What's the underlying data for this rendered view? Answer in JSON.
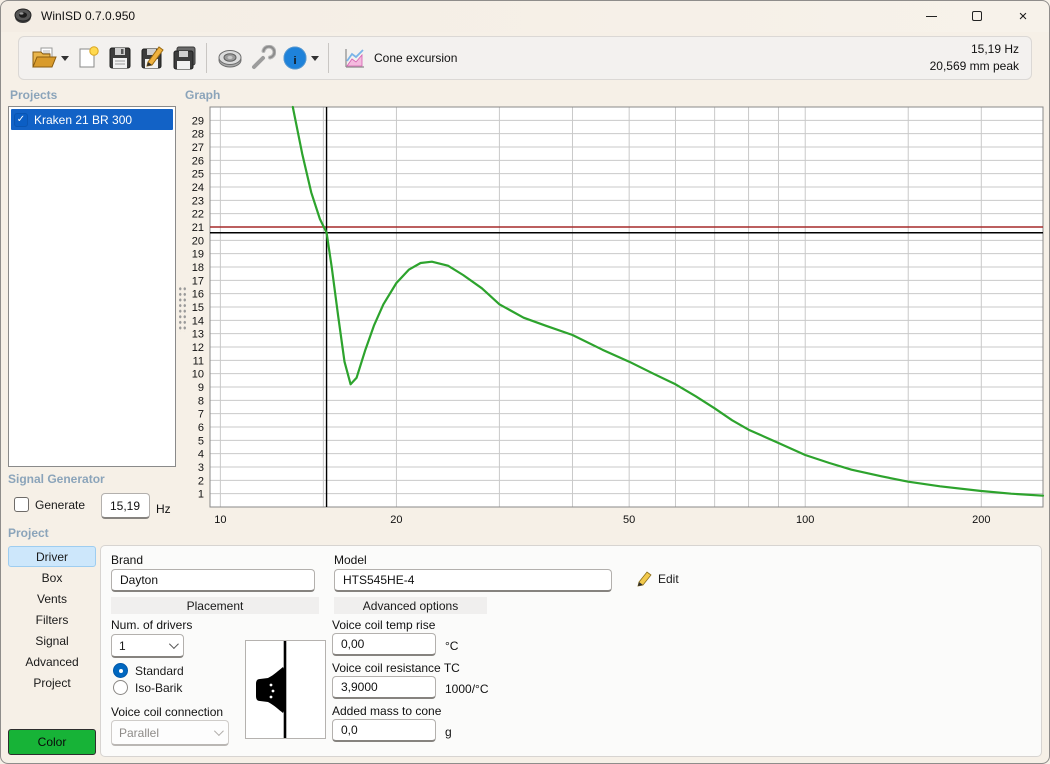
{
  "window": {
    "title": "WinISD 0.7.0.950",
    "controls": {
      "minimize": "minimize",
      "maximize": "maximize",
      "close": "×"
    }
  },
  "toolbar": {
    "buttons": [
      "open-project",
      "new-project",
      "save",
      "save-as",
      "save-all",
      "driver-database",
      "options",
      "info"
    ],
    "view_label": "Cone excursion",
    "readout_line1": "15,19 Hz",
    "readout_line2": "20,569 mm peak"
  },
  "projects": {
    "header": "Projects",
    "items": [
      {
        "label": "Kraken 21 BR 300",
        "checked": true,
        "selected": true
      }
    ]
  },
  "graph": {
    "header": "Graph"
  },
  "chart_data": {
    "type": "line",
    "title": "Cone excursion",
    "xlabel": "",
    "ylabel": "",
    "x_scale": "log",
    "xlim": [
      9.6,
      255
    ],
    "ylim": [
      0,
      30
    ],
    "grid": true,
    "x_tick_labels": [
      10,
      20,
      50,
      100,
      200
    ],
    "x_gridlines": [
      10,
      15,
      20,
      30,
      40,
      50,
      60,
      70,
      80,
      90,
      100,
      150,
      200
    ],
    "y_ticks": [
      1,
      2,
      3,
      4,
      5,
      6,
      7,
      8,
      9,
      10,
      11,
      12,
      13,
      14,
      15,
      16,
      17,
      18,
      19,
      20,
      21,
      22,
      23,
      24,
      25,
      26,
      27,
      28,
      29
    ],
    "reference_lines": [
      {
        "label": "limit-line",
        "orientation": "horizontal",
        "value": 21,
        "color": "#a52a2a"
      },
      {
        "label": "cursor-excursion",
        "orientation": "horizontal",
        "value": 20.569,
        "color": "#000000"
      },
      {
        "label": "cursor-frequency",
        "orientation": "vertical",
        "value": 15.19,
        "color": "#000000"
      }
    ],
    "series": [
      {
        "name": "Kraken 21 BR 300",
        "color": "#2da32d",
        "points": [
          [
            13.3,
            30
          ],
          [
            13.8,
            26.5
          ],
          [
            14.3,
            23.6
          ],
          [
            14.8,
            21.6
          ],
          [
            15.19,
            20.57
          ],
          [
            15.5,
            18.0
          ],
          [
            15.9,
            14.3
          ],
          [
            16.3,
            10.9
          ],
          [
            16.7,
            9.2
          ],
          [
            17.1,
            9.7
          ],
          [
            17.7,
            11.8
          ],
          [
            18.3,
            13.6
          ],
          [
            19,
            15.2
          ],
          [
            20,
            16.8
          ],
          [
            21,
            17.8
          ],
          [
            22,
            18.3
          ],
          [
            23,
            18.4
          ],
          [
            24.5,
            18.1
          ],
          [
            26,
            17.4
          ],
          [
            28,
            16.4
          ],
          [
            30,
            15.2
          ],
          [
            33,
            14.2
          ],
          [
            36,
            13.6
          ],
          [
            40,
            12.9
          ],
          [
            45,
            11.8
          ],
          [
            50,
            10.9
          ],
          [
            55,
            10.0
          ],
          [
            60,
            9.2
          ],
          [
            65,
            8.3
          ],
          [
            70,
            7.4
          ],
          [
            75,
            6.5
          ],
          [
            80,
            5.8
          ],
          [
            90,
            4.8
          ],
          [
            100,
            3.9
          ],
          [
            110,
            3.3
          ],
          [
            120,
            2.8
          ],
          [
            135,
            2.3
          ],
          [
            150,
            1.9
          ],
          [
            170,
            1.55
          ],
          [
            200,
            1.2
          ],
          [
            225,
            1.0
          ],
          [
            255,
            0.85
          ]
        ]
      }
    ]
  },
  "signal_generator": {
    "header": "Signal Generator",
    "generate_label": "Generate",
    "frequency_value": "15,19",
    "frequency_unit": "Hz"
  },
  "project_section": {
    "header": "Project",
    "tabs": [
      "Driver",
      "Box",
      "Vents",
      "Filters",
      "Signal",
      "Advanced",
      "Project"
    ],
    "active_tab": "Driver",
    "color_button_label": "Color"
  },
  "driver_form": {
    "brand_label": "Brand",
    "brand_value": "Dayton",
    "model_label": "Model",
    "model_value": "HTS545HE-4",
    "edit_label": "Edit",
    "subtabs": [
      "Placement",
      "Advanced options"
    ],
    "num_drivers_label": "Num. of drivers",
    "num_drivers_value": "1",
    "mounting_options": [
      {
        "label": "Standard",
        "selected": true
      },
      {
        "label": "Iso-Barik",
        "selected": false
      }
    ],
    "vc_connection_label": "Voice coil connection",
    "vc_connection_value": "Parallel",
    "fields": [
      {
        "label": "Voice coil temp rise",
        "value": "0,00",
        "unit": "°C"
      },
      {
        "label": "Voice coil resistance TC",
        "value": "3,9000",
        "unit": "1000/°C"
      },
      {
        "label": "Added mass to cone",
        "value": "0,0",
        "unit": "g"
      }
    ]
  }
}
